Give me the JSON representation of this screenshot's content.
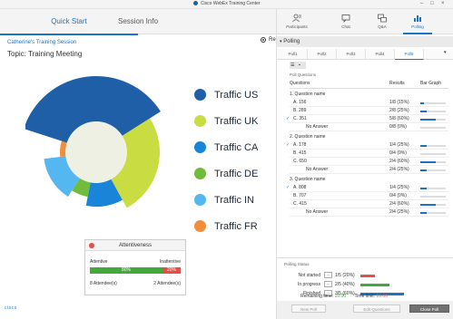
{
  "window": {
    "title": "Cisco WebEx Training Center"
  },
  "left_tabs": [
    {
      "label": "Quick Start"
    },
    {
      "label": "Session Info"
    }
  ],
  "session": {
    "name": "Catherine's Training Session",
    "topic": "Topic: Training Meeting",
    "record_label": "Record"
  },
  "chart_data": {
    "type": "pie",
    "categories": [
      "Traffic US",
      "Traffic UK",
      "Traffic CA",
      "Traffic DE",
      "Traffic IN",
      "Traffic FR"
    ],
    "series": [
      {
        "values": [
          36,
          26,
          11,
          6,
          14,
          7
        ]
      }
    ],
    "colors": [
      "#1f5fa8",
      "#c9dc42",
      "#1a84d9",
      "#6fbd3a",
      "#55b7f0",
      "#f08e3b"
    ],
    "legend": "right"
  },
  "attentiveness": {
    "title": "Attentiveness",
    "attentive_label": "Attentive",
    "inattentive_label": "Inattentive",
    "attentive_pct": "80%",
    "inattentive_pct": "20%",
    "attentive_fraction": 0.8,
    "attentive_count": "8 Attendee(s)",
    "inattentive_count": "2 Attendee(s)"
  },
  "brand": "cisco",
  "right_tabs": [
    {
      "label": "Participants"
    },
    {
      "label": "Chat"
    },
    {
      "label": "Q&A"
    },
    {
      "label": "Polling"
    }
  ],
  "polling": {
    "title": "Polling",
    "poll_tabs": [
      "Poll1",
      "Poll2",
      "Poll3",
      "Poll4",
      "Poll5"
    ],
    "section_label": "Poll Questions",
    "columns": {
      "questions": "Questions",
      "results": "Results",
      "bar": "Bar Graph"
    },
    "questions": [
      {
        "title": "1. Question name",
        "rows": [
          {
            "opt": "A. 156",
            "res": "1/8 (15%)",
            "frac": 0.15,
            "check": false
          },
          {
            "opt": "B. 289",
            "res": "2/8 (25%)",
            "frac": 0.25,
            "check": false
          },
          {
            "opt": "C. 351",
            "res": "5/8 (60%)",
            "frac": 0.6,
            "check": true
          },
          {
            "opt": "No Answer",
            "res": "0/8 (0%)",
            "frac": 0,
            "check": false,
            "noans": true
          }
        ]
      },
      {
        "title": "2. Question name",
        "rows": [
          {
            "opt": "A. 178",
            "res": "1/4 (25%)",
            "frac": 0.25,
            "check": true
          },
          {
            "opt": "B. 415",
            "res": "0/4 (0%)",
            "frac": 0,
            "check": false
          },
          {
            "opt": "C. 650",
            "res": "2/4 (60%)",
            "frac": 0.6,
            "check": false
          },
          {
            "opt": "No Answer",
            "res": "2/4 (25%)",
            "frac": 0.25,
            "check": false,
            "noans": true
          }
        ]
      },
      {
        "title": "3. Question name",
        "rows": [
          {
            "opt": "A. 808",
            "res": "1/4 (25%)",
            "frac": 0.25,
            "check": true
          },
          {
            "opt": "B. 707",
            "res": "0/4 (0%)",
            "frac": 0,
            "check": false
          },
          {
            "opt": "C. 415",
            "res": "2/4 (60%)",
            "frac": 0.6,
            "check": false
          },
          {
            "opt": "No Answer",
            "res": "2/4 (25%)",
            "frac": 0.25,
            "check": false,
            "noans": true
          }
        ]
      }
    ],
    "status": {
      "label": "Polling Status",
      "rows": [
        {
          "name": "Not started",
          "val": "1/5 (20%)",
          "frac": 0.2,
          "color": "#e2504a"
        },
        {
          "name": "In progress",
          "val": "2/5 (40%)",
          "frac": 0.4,
          "color": "#44a83c"
        },
        {
          "name": "Finished",
          "val": "3/5 (60%)",
          "frac": 0.6,
          "color": "#1a73c4"
        }
      ],
      "remaining_label": "Remaining time:",
      "remaining_value": "10:00",
      "limit_label": "Time limit:",
      "limit_value": "10:00"
    },
    "buttons": {
      "new_poll": "New Poll",
      "edit": "Edit Questions",
      "close": "Close Poll"
    }
  }
}
